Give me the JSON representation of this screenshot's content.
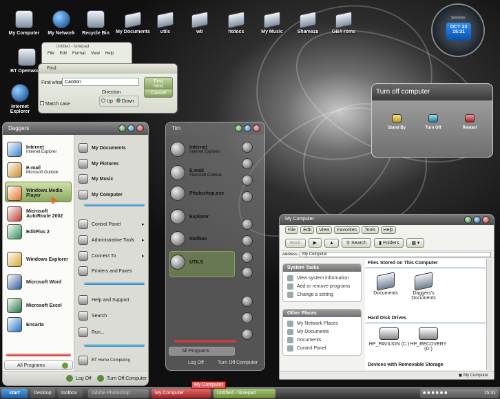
{
  "desktop": {
    "icons": [
      {
        "label": "My Computer",
        "icon": "computer-icon"
      },
      {
        "label": "My Network",
        "icon": "network-globe-icon"
      },
      {
        "label": "Recycle Bin",
        "icon": "recycle-bin-icon"
      },
      {
        "label": "My Documents",
        "icon": "documents-folder-icon"
      },
      {
        "label": "utils",
        "icon": "folder-icon"
      },
      {
        "label": "wb",
        "icon": "folder-icon"
      },
      {
        "label": "htdocs",
        "icon": "folder-icon"
      },
      {
        "label": "My Music",
        "icon": "music-folder-icon"
      },
      {
        "label": "Shareaza",
        "icon": "folder-icon"
      },
      {
        "label": "GBA roms",
        "icon": "folder-icon"
      }
    ],
    "left_icons": [
      {
        "label": "BT Openworld",
        "icon": "bt-openworld-icon"
      },
      {
        "label": "Internet Explorer",
        "icon": "internet-explorer-icon"
      }
    ]
  },
  "clock": {
    "date": "OCT 23",
    "time": "15:31",
    "brand": "Samurize"
  },
  "notepad": {
    "title": "Untitled - Notepad",
    "menu": [
      "File",
      "Edit",
      "Format",
      "View",
      "Help"
    ]
  },
  "find": {
    "title": "Find",
    "label": "Find what:",
    "value": "Carillon",
    "find_next": "Find Next",
    "cancel": "Cancel",
    "match_case": "Match case",
    "direction": "Direction",
    "up": "Up",
    "down": "Down"
  },
  "turnoff": {
    "title": "Turn off computer",
    "options": [
      "Stand By",
      "Turn Off",
      "Restart"
    ]
  },
  "start_menu": {
    "user": "Daggers",
    "pinned": [
      {
        "title": "Internet",
        "sub": "Internet Explorer",
        "color": "#3d7ecf"
      },
      {
        "title": "E-mail",
        "sub": "Microsoft Outlook",
        "color": "#c98a2a"
      }
    ],
    "recent": [
      {
        "title": "Windows Media Player",
        "color": "#e07020"
      },
      {
        "title": "Microsoft AutoRoute 2002",
        "color": "#c0392b"
      },
      {
        "title": "EditPlus 2",
        "color": "#2e8b57"
      },
      {
        "title": "Windows Explorer",
        "color": "#d9a62e"
      },
      {
        "title": "Microsoft Word",
        "color": "#2b579a"
      },
      {
        "title": "Microsoft Excel",
        "color": "#217346"
      },
      {
        "title": "Encarta",
        "color": "#1e6fbf"
      }
    ],
    "all_programs": "All Programs",
    "right": [
      "My Documents",
      "My Pictures",
      "My Music",
      "My Computer",
      "Control Panel",
      "Administrative Tools",
      "Connect To",
      "Printers and Faxes",
      "Help and Support",
      "Search",
      "Run...",
      "BT Home Computing"
    ],
    "log_off": "Log Off",
    "turn_off": "Turn Off Computer"
  },
  "ghost_menu": {
    "user": "Tim",
    "items": [
      {
        "title": "Internet",
        "sub": "Internet Explorer"
      },
      {
        "title": "E-mail",
        "sub": "Microsoft Outlook"
      },
      {
        "title": "Photoshop.exe",
        "sub": ""
      },
      {
        "title": "Explorer",
        "sub": ""
      },
      {
        "title": "toolbox",
        "sub": ""
      },
      {
        "title": "UTILS",
        "sub": ""
      }
    ],
    "all_programs": "All Programs",
    "log_off": "Log Off",
    "turn_off": "Turn Off Computer"
  },
  "explorer": {
    "title": "My Computer",
    "menu": [
      "File",
      "Edit",
      "View",
      "Favorites",
      "Tools",
      "Help"
    ],
    "toolbar": {
      "back": "Back",
      "search": "Search",
      "folders": "Folders"
    },
    "address_label": "Address",
    "address": "My Computer",
    "system_tasks": {
      "title": "System Tasks",
      "items": [
        "View system information",
        "Add or remove programs",
        "Change a setting"
      ]
    },
    "other_places": {
      "title": "Other Places",
      "items": [
        "My Network Places",
        "My Documents",
        "Documents",
        "Control Panel"
      ]
    },
    "sections": {
      "stored": "Files Stored on This Computer",
      "drives": "Hard Disk Drives",
      "removable": "Devices with Removable Storage"
    },
    "files": [
      "Documents",
      "Daggers's Documents"
    ],
    "drives": [
      "HP_PAVILION (C:)",
      "HP_RECOVERY (D:)"
    ],
    "status": "My Computer"
  },
  "taskbar": {
    "start": "start",
    "toolbars": [
      "Desktop",
      "toolbox"
    ],
    "tasks": [
      "Adobe Photoshop",
      "My Computer",
      "Untitled - Notepad"
    ],
    "tooltip": "My Computer",
    "time": "15:31"
  }
}
